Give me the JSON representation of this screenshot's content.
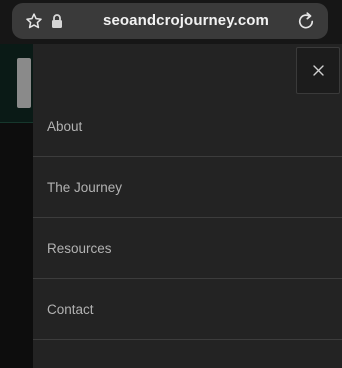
{
  "browser": {
    "url": "seoandcrojourney.com",
    "icons": {
      "bookmark": "star-icon",
      "secure": "lock-icon",
      "reload": "reload-icon"
    }
  },
  "drawer": {
    "close_icon": "close-icon",
    "menu_items": [
      {
        "label": "About"
      },
      {
        "label": "The Journey"
      },
      {
        "label": "Resources"
      },
      {
        "label": "Contact"
      }
    ]
  },
  "colors": {
    "drawer_bg": "#232323",
    "menu_text": "#b2b2b2",
    "divider": "#3c3c3c",
    "url_pill": "#3a3a3a"
  }
}
